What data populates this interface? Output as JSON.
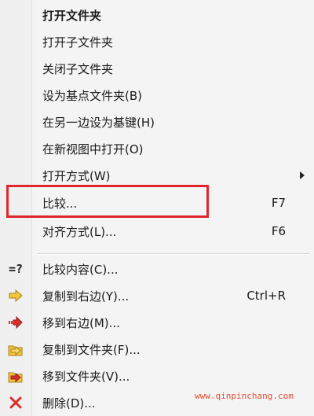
{
  "menu": {
    "items": [
      {
        "label": "打开文件夹",
        "shortcut": "",
        "bold": true
      },
      {
        "label": "打开子文件夹",
        "shortcut": ""
      },
      {
        "label": "关闭子文件夹",
        "shortcut": ""
      },
      {
        "label": "设为基点文件夹(B)",
        "shortcut": ""
      },
      {
        "label": "在另一边设为基键(H)",
        "shortcut": ""
      },
      {
        "label": "在新视图中打开(O)",
        "shortcut": ""
      },
      {
        "label": "打开方式(W)",
        "shortcut": "",
        "submenu": true
      },
      {
        "label": "比较...",
        "shortcut": "F7"
      },
      {
        "label": "对齐方式(L)...",
        "shortcut": "F6"
      },
      {
        "label": "比较内容(C)...",
        "shortcut": "",
        "icon": "compare-contents-icon",
        "icon_text": "=?"
      },
      {
        "label": "复制到右边(Y)...",
        "shortcut": "Ctrl+R",
        "icon": "copy-right-arrow-icon"
      },
      {
        "label": "移到右边(M)...",
        "shortcut": "",
        "icon": "move-right-arrow-icon"
      },
      {
        "label": "复制到文件夹(F)...",
        "shortcut": "",
        "icon": "copy-to-folder-icon"
      },
      {
        "label": "移到文件夹(V)...",
        "shortcut": "",
        "icon": "move-to-folder-icon"
      },
      {
        "label": "删除(D)...",
        "shortcut": "",
        "icon": "delete-x-icon"
      }
    ]
  },
  "watermark": "www.qinpinchang.com",
  "colors": {
    "highlight": "#e0252d",
    "arrow_yellow": "#f2c53d",
    "arrow_red": "#d9302c"
  }
}
